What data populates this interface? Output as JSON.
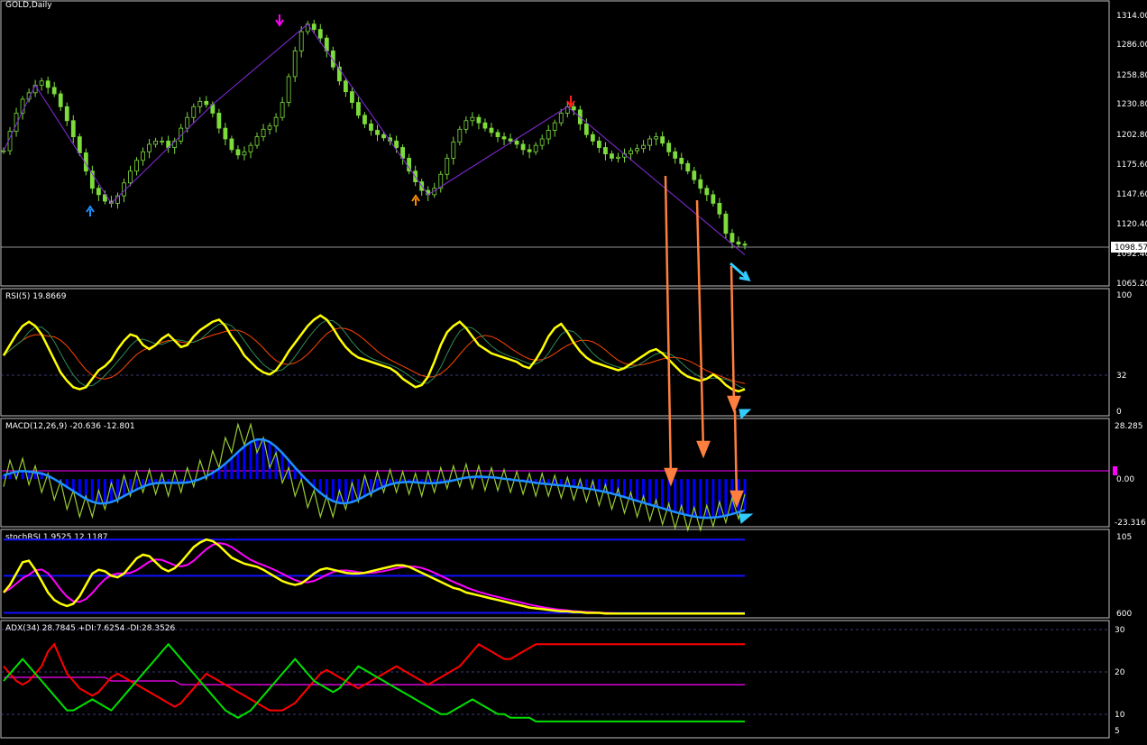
{
  "colors": {
    "background": "#000000",
    "grid_frame": "#c0c0c0",
    "bull_candle": "#7ddc3c",
    "bear_candle": "#7ddc3c",
    "zigzag": "#8a2be2",
    "rsi_main": "#ffff00",
    "rsi_ma1": "#2e8b57",
    "rsi_ma2": "#ff4500",
    "macd_hist_pos": "#0000ff",
    "macd_line": "#9acd32",
    "macd_signal": "#1e90ff",
    "stoch_k": "#ffff00",
    "stoch_d": "#ff00ff",
    "stoch_band": "#1010ff",
    "adx_plus": "#00e000",
    "adx_minus": "#ff0000",
    "adx_main": "#ff00ff",
    "arrow_orange": "#ff7f3f",
    "arrow_cyan": "#33ccff",
    "level_line": "#5050a0"
  },
  "panels": {
    "price": {
      "title": "GOLD,Daily",
      "ticks": [
        "1314.00",
        "1286.00",
        "1258.80",
        "1230.80",
        "1202.80",
        "1175.60",
        "1147.60",
        "1120.40",
        "1092.40",
        "1065.20"
      ],
      "current_price": "1098.57",
      "ylim": [
        1065.2,
        1314.0
      ]
    },
    "rsi": {
      "title": "RSI(5) 19.8669",
      "ticks": [
        "100",
        "32",
        "0"
      ],
      "ylim": [
        0,
        100
      ]
    },
    "macd": {
      "title": "MACD(12,26,9) -20.636 -12.801",
      "ticks": [
        "28.285",
        "0.00",
        "-23.316"
      ],
      "ylim": [
        -23.316,
        28.285
      ]
    },
    "stoch": {
      "title": "stochRSI 1.9525 12.1187",
      "ticks": [
        "105",
        "600"
      ],
      "ylim": [
        0,
        105
      ]
    },
    "adx": {
      "title": "ADX(34) 28.7845 +DI:7.6254 -DI:28.3526",
      "ticks": [
        "30",
        "20",
        "10",
        "5"
      ],
      "ylim": [
        5,
        32
      ]
    }
  },
  "chart_data": {
    "type": "line",
    "price_close": [
      1187,
      1205,
      1222,
      1235,
      1241,
      1248,
      1252,
      1246,
      1240,
      1228,
      1215,
      1200,
      1185,
      1168,
      1152,
      1146,
      1140,
      1138,
      1145,
      1157,
      1168,
      1178,
      1186,
      1193,
      1196,
      1196,
      1190,
      1196,
      1208,
      1218,
      1228,
      1233,
      1230,
      1222,
      1208,
      1198,
      1188,
      1183,
      1186,
      1192,
      1200,
      1207,
      1210,
      1218,
      1232,
      1256,
      1280,
      1298,
      1305,
      1300,
      1292,
      1280,
      1265,
      1252,
      1242,
      1232,
      1220,
      1212,
      1206,
      1202,
      1199,
      1196,
      1190,
      1180,
      1168,
      1158,
      1150,
      1146,
      1152,
      1165,
      1180,
      1195,
      1207,
      1215,
      1218,
      1213,
      1208,
      1204,
      1200,
      1198,
      1196,
      1193,
      1188,
      1186,
      1192,
      1198,
      1206,
      1213,
      1222,
      1228,
      1225,
      1212,
      1202,
      1196,
      1190,
      1184,
      1180,
      1181,
      1184,
      1187,
      1189,
      1192,
      1198,
      1200,
      1194,
      1186,
      1180,
      1175,
      1168,
      1160,
      1152,
      1146,
      1138,
      1128,
      1110,
      1102,
      1100,
      1099
    ],
    "rsi": [
      52,
      62,
      72,
      80,
      84,
      80,
      72,
      60,
      48,
      36,
      28,
      22,
      20,
      22,
      30,
      38,
      42,
      48,
      58,
      66,
      72,
      70,
      62,
      58,
      62,
      68,
      72,
      66,
      60,
      62,
      70,
      76,
      80,
      84,
      86,
      80,
      70,
      62,
      52,
      46,
      40,
      36,
      34,
      38,
      46,
      56,
      64,
      72,
      80,
      86,
      90,
      86,
      78,
      68,
      60,
      54,
      50,
      48,
      46,
      44,
      42,
      40,
      36,
      30,
      26,
      22,
      24,
      32,
      46,
      62,
      74,
      80,
      84,
      78,
      70,
      62,
      58,
      54,
      52,
      50,
      48,
      46,
      42,
      40,
      48,
      58,
      70,
      78,
      82,
      74,
      64,
      56,
      50,
      46,
      44,
      42,
      40,
      38,
      40,
      44,
      48,
      52,
      56,
      58,
      54,
      48,
      42,
      36,
      32,
      30,
      28,
      30,
      34,
      30,
      24,
      20,
      18,
      20
    ],
    "macd": [
      2,
      4,
      6,
      5,
      3,
      1,
      -1,
      -3,
      -5,
      -7,
      -10,
      -12,
      -14,
      -15,
      -14,
      -12,
      -10,
      -8,
      -6,
      -4,
      -3,
      -2,
      -1,
      -1,
      -2,
      -3,
      -3,
      -2,
      -1,
      0,
      2,
      4,
      6,
      9,
      12,
      16,
      20,
      23,
      24,
      23,
      20,
      16,
      12,
      8,
      4,
      0,
      -3,
      -6,
      -9,
      -12,
      -14,
      -15,
      -14,
      -12,
      -10,
      -8,
      -6,
      -4,
      -3,
      -2,
      -1,
      -1,
      -1,
      -2,
      -2,
      -3,
      -3,
      -2,
      -1,
      0,
      1,
      1,
      2,
      2,
      1,
      1,
      0,
      0,
      0,
      -1,
      -1,
      -2,
      -2,
      -3,
      -3,
      -3,
      -3,
      -4,
      -4,
      -5,
      -5,
      -6,
      -6,
      -7,
      -8,
      -9,
      -10,
      -11,
      -12,
      -13,
      -14,
      -15,
      -16,
      -17,
      -18,
      -19,
      -20,
      -20,
      -21,
      -21,
      -21,
      -20,
      -19,
      -18,
      -17,
      -16,
      -15,
      -14
    ],
    "stoch": [
      30,
      40,
      55,
      70,
      72,
      60,
      45,
      30,
      20,
      15,
      12,
      15,
      25,
      40,
      55,
      60,
      58,
      52,
      50,
      55,
      65,
      75,
      80,
      78,
      70,
      62,
      58,
      62,
      70,
      80,
      90,
      96,
      100,
      98,
      92,
      84,
      76,
      72,
      68,
      66,
      64,
      60,
      55,
      50,
      45,
      42,
      40,
      42,
      48,
      55,
      60,
      62,
      60,
      58,
      56,
      55,
      55,
      56,
      58,
      60,
      62,
      64,
      66,
      66,
      64,
      60,
      56,
      52,
      48,
      44,
      40,
      36,
      34,
      30,
      28,
      26,
      24,
      22,
      20,
      18,
      16,
      14,
      12,
      10,
      9,
      8,
      7,
      6,
      5,
      5,
      4,
      4,
      3,
      3,
      3,
      2,
      2,
      2,
      2,
      2,
      2,
      2,
      2,
      2,
      2,
      2,
      2,
      2,
      2,
      2,
      2,
      2,
      2,
      2,
      2,
      2,
      2,
      2
    ],
    "adx_plus": [
      18,
      20,
      22,
      24,
      22,
      20,
      18,
      16,
      14,
      12,
      10,
      10,
      11,
      12,
      13,
      12,
      11,
      10,
      12,
      14,
      16,
      18,
      20,
      22,
      24,
      26,
      28,
      26,
      24,
      22,
      20,
      18,
      16,
      14,
      12,
      10,
      9,
      8,
      9,
      10,
      12,
      14,
      16,
      18,
      20,
      22,
      24,
      22,
      20,
      18,
      17,
      16,
      15,
      16,
      18,
      20,
      22,
      21,
      20,
      19,
      18,
      17,
      16,
      15,
      14,
      13,
      12,
      11,
      10,
      9,
      9,
      10,
      11,
      12,
      13,
      12,
      11,
      10,
      9,
      9,
      8,
      8,
      8,
      8,
      7,
      7,
      7,
      7,
      7,
      7,
      7,
      7,
      7,
      7,
      7,
      7,
      7,
      7,
      7,
      7,
      7,
      7,
      7,
      7,
      7,
      7,
      7,
      7,
      7,
      7,
      7,
      7,
      7,
      7,
      7,
      7,
      7,
      7
    ],
    "adx_minus": [
      22,
      20,
      18,
      17,
      18,
      20,
      22,
      26,
      28,
      24,
      20,
      18,
      16,
      15,
      14,
      15,
      17,
      19,
      20,
      19,
      18,
      17,
      16,
      15,
      14,
      13,
      12,
      11,
      12,
      14,
      16,
      18,
      20,
      19,
      18,
      17,
      16,
      15,
      14,
      13,
      12,
      11,
      10,
      10,
      10,
      11,
      12,
      14,
      16,
      18,
      20,
      21,
      20,
      19,
      18,
      17,
      16,
      17,
      18,
      19,
      20,
      21,
      22,
      21,
      20,
      19,
      18,
      17,
      18,
      19,
      20,
      21,
      22,
      24,
      26,
      28,
      27,
      26,
      25,
      24,
      24,
      25,
      26,
      27,
      28,
      28,
      28,
      28,
      28,
      28,
      28,
      28,
      28,
      28,
      28,
      28,
      28,
      28,
      28,
      28,
      28,
      28,
      28,
      28,
      28,
      28,
      28,
      28,
      28,
      28,
      28,
      28,
      28,
      28,
      28,
      28,
      28,
      28
    ],
    "adx_main": [
      19,
      19,
      19,
      19,
      19,
      19,
      19,
      19,
      19,
      19,
      19,
      19,
      19,
      19,
      19,
      19,
      19,
      18,
      18,
      18,
      18,
      18,
      18,
      18,
      18,
      18,
      18,
      18,
      17,
      17,
      17,
      17,
      17,
      17,
      17,
      17,
      17,
      17,
      17,
      17,
      17,
      17,
      17,
      17,
      17,
      17,
      17,
      17,
      17,
      17,
      17,
      17,
      17,
      17,
      17,
      17,
      17,
      17,
      17,
      17,
      17,
      17,
      17,
      17,
      17,
      17,
      17,
      17,
      17,
      17,
      17,
      17,
      17,
      17,
      17,
      17,
      17,
      17,
      17,
      17,
      17,
      17,
      17,
      17,
      17,
      17,
      17,
      17,
      17,
      17,
      17,
      17,
      17,
      17,
      17,
      17,
      17,
      17,
      17,
      17,
      17,
      17,
      17,
      17,
      17,
      17,
      17,
      17,
      17,
      17,
      17,
      17,
      17,
      17,
      17,
      17,
      17,
      17
    ],
    "grid": false,
    "legend": "top-left"
  }
}
